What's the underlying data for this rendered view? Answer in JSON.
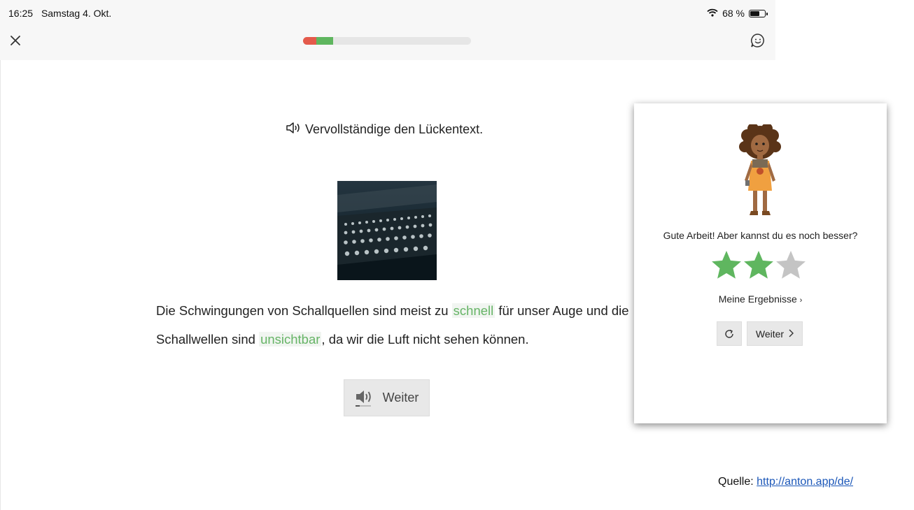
{
  "status_bar": {
    "time": "16:25",
    "date": "Samstag 4. Okt.",
    "battery": "68 %",
    "battery_level": 0.68
  },
  "progress": {
    "wrong_fraction": 0.08,
    "correct_fraction": 0.1
  },
  "exercise": {
    "instruction": "Vervollständige den Lückentext.",
    "sentence_parts": [
      "Die Schwingungen von Schallquellen sind meist zu ",
      "schnell",
      " für unser Auge und die Schallwellen sind ",
      "unsichtbar",
      ", da wir die Luft nicht sehen können."
    ],
    "continue_label": "Weiter"
  },
  "result_popup": {
    "message": "Gute Arbeit! Aber kannst du es noch besser?",
    "stars_earned": 2,
    "stars_total": 3,
    "results_link": "Meine Ergebnisse",
    "continue_label": "Weiter"
  },
  "source": {
    "label": "Quelle:",
    "url": "http://anton.app/de/"
  },
  "colors": {
    "correct": "#5fb65f",
    "wrong": "#e45a4b",
    "star_empty": "#c4c4c4",
    "link": "#1a56b8"
  },
  "icons": [
    "close-icon",
    "wifi-icon",
    "battery-icon",
    "chat-smiley-icon",
    "speaker-icon",
    "refresh-icon",
    "chevron-right-icon"
  ]
}
